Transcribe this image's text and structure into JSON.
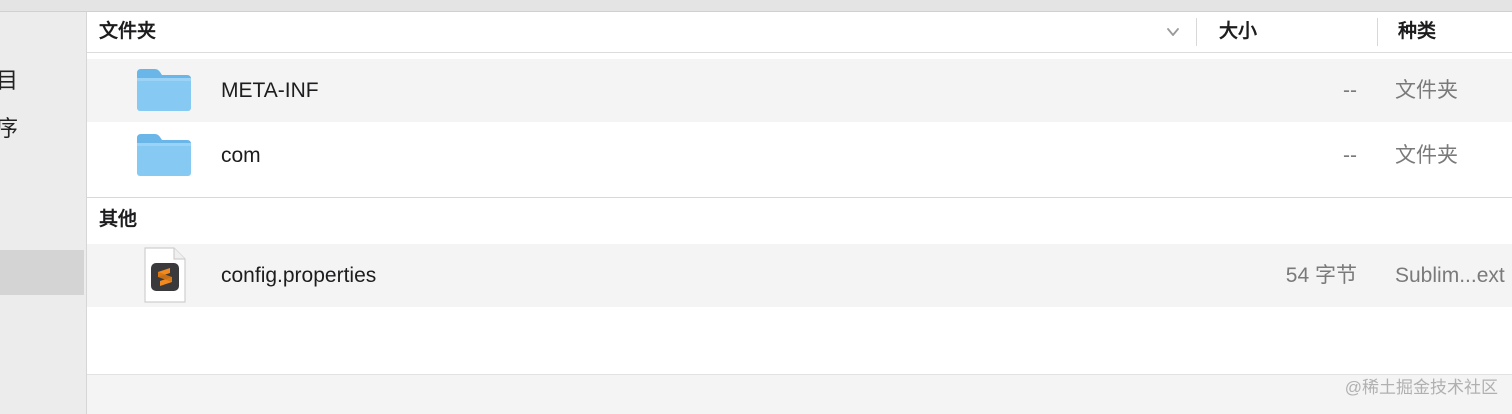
{
  "sidebar": {
    "items": [
      {
        "label": "目",
        "icon": ""
      },
      {
        "label": "序",
        "icon": ""
      },
      {
        "label": "",
        "icon": ""
      }
    ]
  },
  "header": {
    "name_label": "文件夹",
    "size_label": "大小",
    "kind_label": "种类",
    "sort_icon": "chevron-down-icon"
  },
  "folders": [
    {
      "name": "META-INF",
      "size": "--",
      "kind": "文件夹",
      "icon": "folder-icon"
    },
    {
      "name": "com",
      "size": "--",
      "kind": "文件夹",
      "icon": "folder-icon"
    }
  ],
  "others_section": {
    "title": "其他",
    "files": [
      {
        "name": "config.properties",
        "size": "54 字节",
        "kind": "Sublim...ext",
        "icon": "sublime-text-document-icon"
      }
    ]
  },
  "watermark": "@稀土掘金技术社区",
  "colors": {
    "folder_blue": "#7cc3ef",
    "selected_row": "#d4d4d4",
    "sublime_orange": "#f28b1f"
  }
}
